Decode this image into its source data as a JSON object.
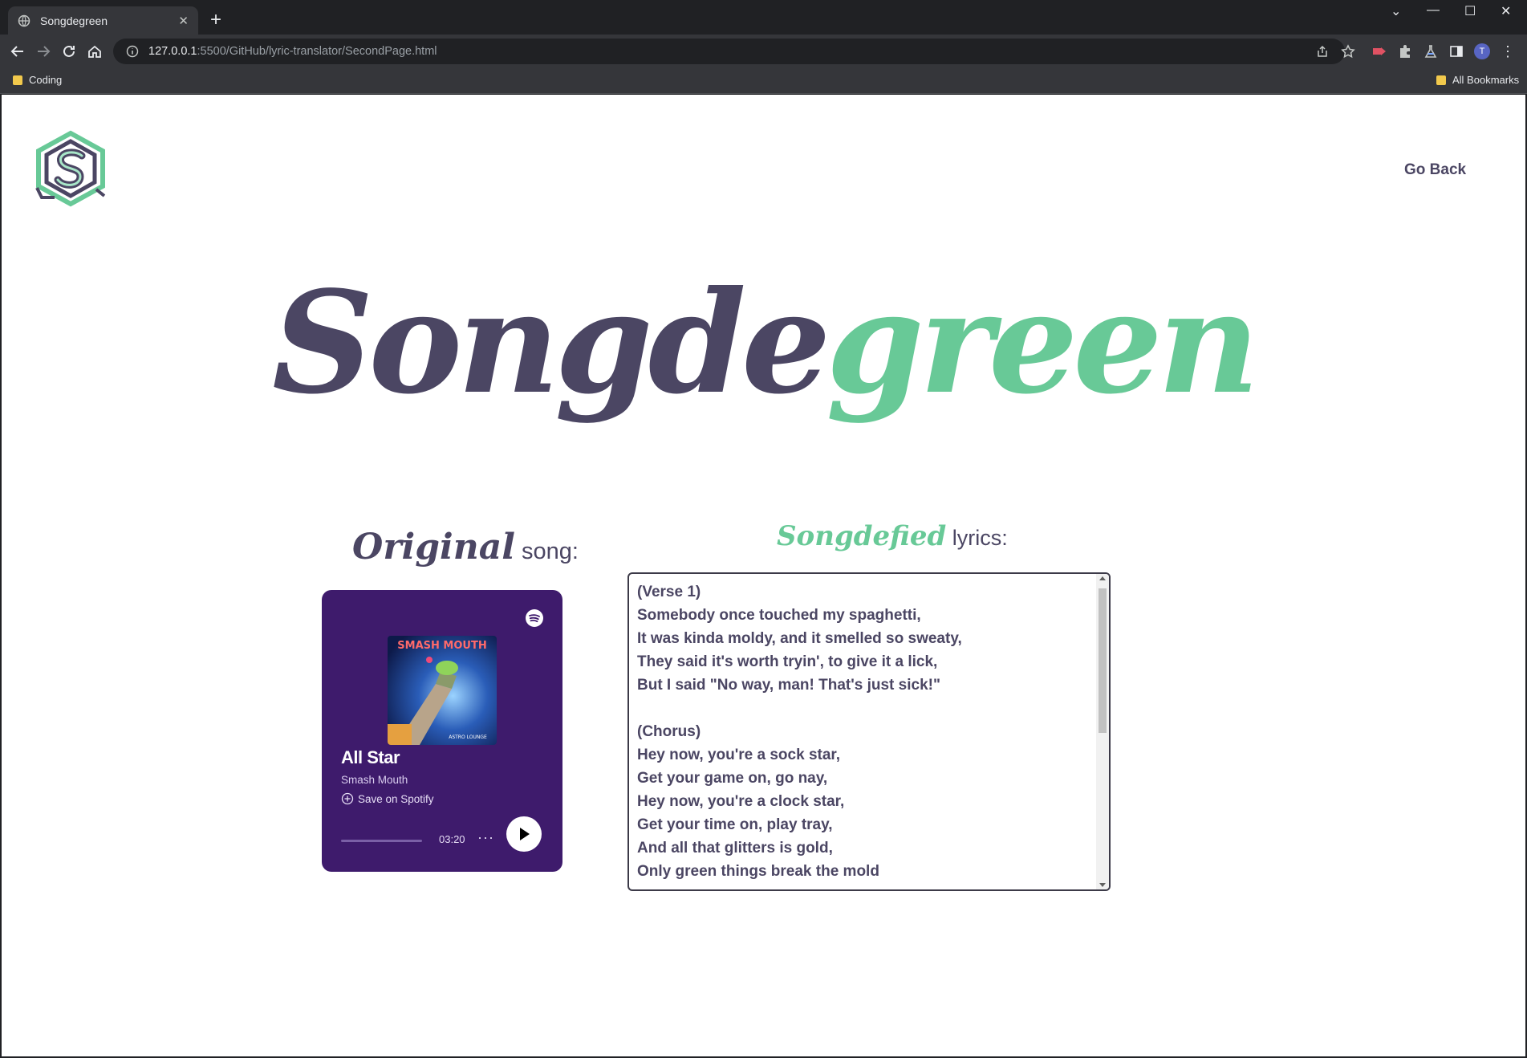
{
  "browser": {
    "tab_title": "Songdegreen",
    "url_host": "127.0.0.1",
    "url_rest": ":5500/GitHub/lyric-translator/SecondPage.html",
    "bookmark_folder": "Coding",
    "all_bookmarks": "All Bookmarks",
    "profile_initial": "T"
  },
  "nav": {
    "go_back": "Go Back"
  },
  "brand": {
    "part1": "Songde",
    "part2": "green"
  },
  "original_heading": {
    "script": "Original",
    "rest": "song:"
  },
  "songdefied_heading": {
    "script": "Songdefied",
    "rest": "lyrics:"
  },
  "spotify": {
    "track": "All Star",
    "artist": "Smash Mouth",
    "save_label": "Save on Spotify",
    "duration": "03:20",
    "album_art_text": "SMASH MOUTH",
    "album_sub_text": "ASTRO LOUNGE",
    "progress": 0
  },
  "lyrics": {
    "text": "(Verse 1)\nSomebody once touched my spaghetti,\nIt was kinda moldy, and it smelled so sweaty,\nThey said it's worth tryin', to give it a lick,\nBut I said \"No way, man! That's just sick!\"\n\n(Chorus)\nHey now, you're a sock star,\nGet your game on, go nay,\nHey now, you're a clock star,\nGet your time on, play tray,\nAnd all that glitters is gold,\nOnly green things break the mold"
  },
  "colors": {
    "brand_dark": "#4b4663",
    "brand_green": "#68c997",
    "spotify_bg": "#3e1b6c"
  }
}
